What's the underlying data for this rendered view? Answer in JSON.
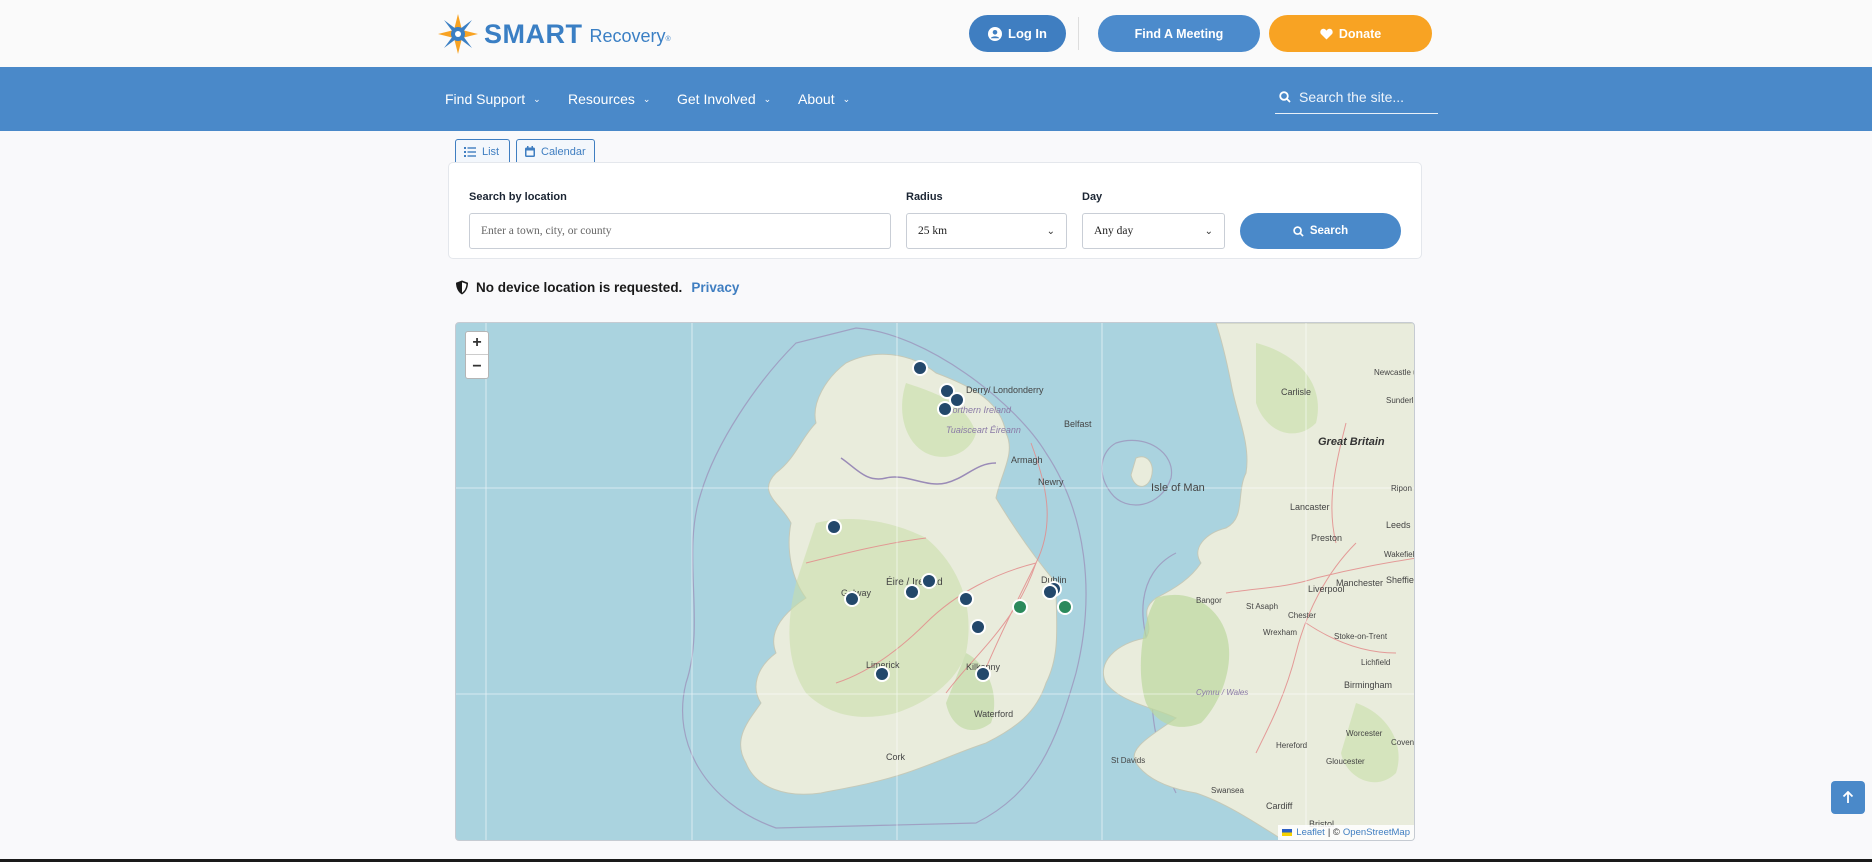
{
  "header": {
    "brand": "SMART",
    "brand_suffix": "Recovery",
    "reg_mark": "®",
    "login_label": "Log In",
    "find_meeting_label": "Find A Meeting",
    "donate_label": "Donate",
    "colors": {
      "primary": "#4a89c9",
      "accent": "#f8a323"
    }
  },
  "nav": {
    "items": [
      {
        "label": "Find Support"
      },
      {
        "label": "Resources"
      },
      {
        "label": "Get Involved"
      },
      {
        "label": "About"
      }
    ],
    "search_placeholder": "Search the site..."
  },
  "view_tabs": [
    {
      "label": "List",
      "icon": "list-icon"
    },
    {
      "label": "Calendar",
      "icon": "calendar-icon"
    }
  ],
  "search_form": {
    "location_label": "Search by location",
    "location_placeholder": "Enter a town, city, or county",
    "radius_label": "Radius",
    "radius_value": "25 km",
    "day_label": "Day",
    "day_value": "Any day",
    "search_label": "Search"
  },
  "privacy": {
    "text": "No device location is requested.",
    "link": "Privacy"
  },
  "map": {
    "zoom_in": "+",
    "zoom_out": "−",
    "attribution_leaflet": "Leaflet",
    "attribution_sep": "| ©",
    "attribution_osm": "OpenStreetMap",
    "place_labels": [
      "Derry/ Londonderry",
      "Northern Ireland",
      "Tuaisceart Éireann",
      "Belfast",
      "Armagh",
      "Newry",
      "Isle of Man",
      "Éire / Ireland",
      "Galway",
      "Dublin",
      "Limerick",
      "Kilkenny",
      "Waterford",
      "Cork",
      "Great Britain",
      "Carlisle",
      "Newcastle upon Tyne",
      "Sunderland",
      "Lancaster",
      "Leeds",
      "Ripon",
      "Preston",
      "Wakefield",
      "Sheffield",
      "Liverpool",
      "Manchester",
      "Bangor",
      "St Asaph",
      "Chester",
      "Wrexham",
      "Stoke-on-Trent",
      "Lichfield",
      "Birmingham",
      "Cymru / Wales",
      "Worcester",
      "Coventry",
      "Hereford",
      "Gloucester",
      "St Davids",
      "Swansea",
      "Cardiff",
      "Bristol"
    ],
    "marker_colors": {
      "blue": "#23486b",
      "green": "#2b8a5c"
    }
  }
}
